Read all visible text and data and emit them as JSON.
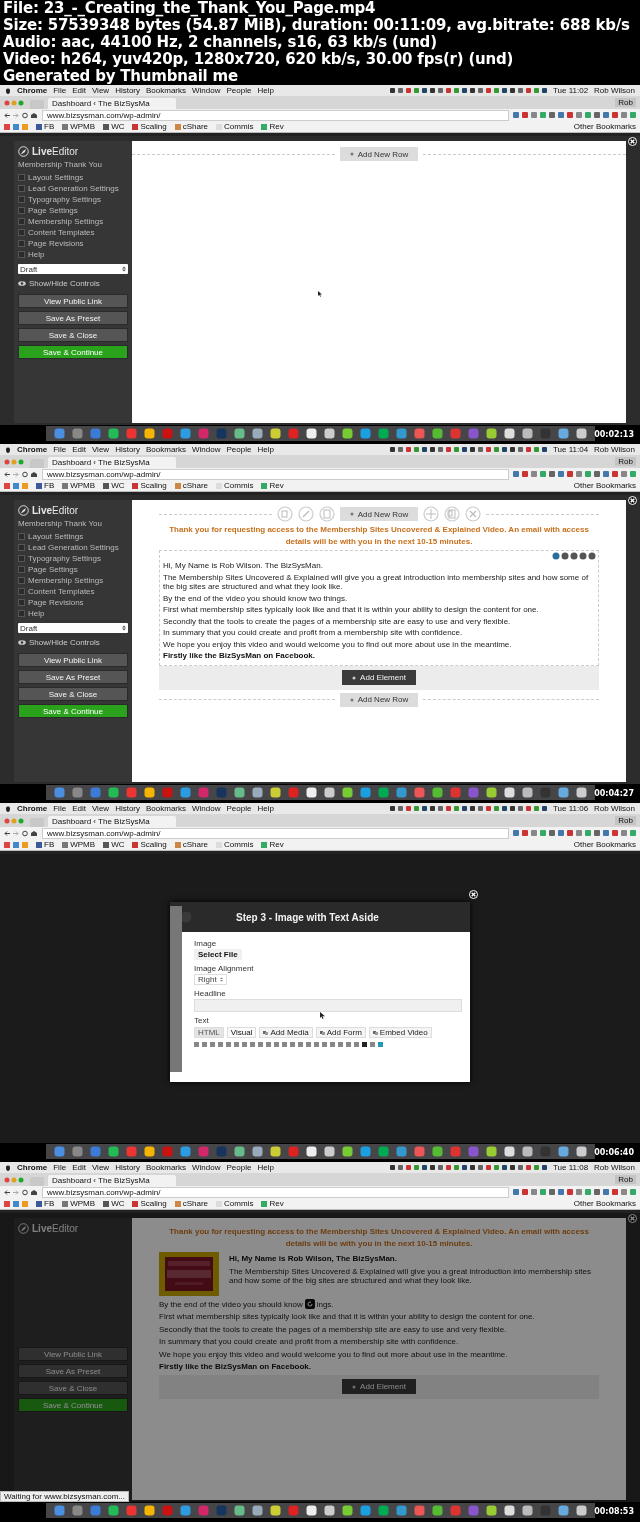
{
  "file_info": [
    "File: 23_-_Creating_the_Thank_You_Page.mp4",
    "Size: 57539348 bytes (54.87 MiB), duration: 00:11:09, avg.bitrate: 688 kb/s",
    "Audio: aac, 44100 Hz, 2 channels, s16, 63 kb/s (und)",
    "Video: h264, yuv420p, 1280x720, 620 kb/s, 30.00 fps(r) (und)",
    "Generated by Thumbnail me"
  ],
  "frames": [
    {
      "kind": "empty",
      "menu_bar": {
        "app": "Chrome",
        "menus": [
          "File",
          "Edit",
          "View",
          "History",
          "Bookmarks",
          "Window",
          "People",
          "Help"
        ],
        "clock": "Tue 11:02",
        "user": "Rob Wilson"
      },
      "browser": {
        "tab_title": "Dashboard ‹ The BizSysMa",
        "profile": "Rob",
        "url": "www.bizsysman.com/wp-admin/",
        "bookmarks": [
          "FB",
          "WPMB",
          "WC",
          "Scaling",
          "cShare",
          "Commis",
          "Rev"
        ],
        "other_bookmarks": "Other Bookmarks"
      },
      "sidebar": {
        "logo": "**Live**Editor",
        "subtitle": "Membership Thank You",
        "items": [
          {
            "label": "Layout Settings",
            "checked": false
          },
          {
            "label": "Lead Generation Settings",
            "checked": false
          },
          {
            "label": "Typography Settings",
            "checked": false
          },
          {
            "label": "Page Settings",
            "checked": false
          },
          {
            "label": "Membership Settings",
            "checked": false
          },
          {
            "label": "Content Templates",
            "checked": false
          },
          {
            "label": "Page Revisions",
            "checked": false
          },
          {
            "label": "Help",
            "checked": false
          }
        ],
        "status": "Draft",
        "toggle": "Show/Hide Controls",
        "buttons": [
          {
            "label": "View Public Link",
            "kind": "default"
          },
          {
            "label": "Save As Preset",
            "kind": "default"
          },
          {
            "label": "Save & Close",
            "kind": "default"
          },
          {
            "label": "Save & Continue",
            "kind": "primary"
          }
        ]
      },
      "add_row": "Add New Row",
      "timestamp": "00:02:13"
    },
    {
      "kind": "content",
      "menu_bar": {
        "app": "Chrome",
        "menus": [
          "File",
          "Edit",
          "View",
          "History",
          "Bookmarks",
          "Window",
          "People",
          "Help"
        ],
        "clock": "Tue 11:04",
        "user": "Rob Wilson"
      },
      "browser": {
        "tab_title": "Dashboard ‹ The BizSysMa",
        "profile": "Rob",
        "url": "www.bizsysman.com/wp-admin/",
        "bookmarks": [
          "FB",
          "WPMB",
          "WC",
          "Scaling",
          "cShare",
          "Commis",
          "Rev"
        ],
        "other_bookmarks": "Other Bookmarks"
      },
      "sidebar": {
        "logo": "**Live**Editor",
        "subtitle": "Membership Thank You",
        "items": [
          {
            "label": "Layout Settings",
            "checked": false
          },
          {
            "label": "Lead Generation Settings",
            "checked": false
          },
          {
            "label": "Typography Settings",
            "checked": false
          },
          {
            "label": "Page Settings",
            "checked": false
          },
          {
            "label": "Membership Settings",
            "checked": false
          },
          {
            "label": "Content Templates",
            "checked": false
          },
          {
            "label": "Page Revisions",
            "checked": false
          },
          {
            "label": "Help",
            "checked": false
          }
        ],
        "status": "Draft",
        "toggle": "Show/Hide Controls",
        "buttons": [
          {
            "label": "View Public Link",
            "kind": "default"
          },
          {
            "label": "Save As Preset",
            "kind": "default"
          },
          {
            "label": "Save & Close",
            "kind": "default"
          },
          {
            "label": "Save & Continue",
            "kind": "primary"
          }
        ]
      },
      "content": {
        "top_row": "Add New Row",
        "headline": "Thank you for requesting access to the Membership Sites Uncovered & Explained Video. An email with access details will be with you in the next 10-15 minutes.",
        "paragraphs": [
          {
            "text": "Hi, My Name is Rob Wilson. The BizSysMan.",
            "bold": false
          },
          {
            "text": "The Membership Sites Uncovered & Explained will give you a great introduction into membership sites and how some of the big sites are structured and what they look like.",
            "bold": false
          },
          {
            "text": "By the end of the video you should know two things.",
            "bold": false
          },
          {
            "text": "First what membership sites typically look like and that it is within your ability to design the content for one.",
            "bold": false
          },
          {
            "text": "Secondly that the tools to create the pages of a membership site are easy to use and very flexible.",
            "bold": false
          },
          {
            "text": "In summary that you could create and profit from a membership site with confidence.",
            "bold": false
          },
          {
            "text": "We hope you enjoy this video and would welcome you to find out more about use in the meantime.",
            "bold": false
          },
          {
            "text": "Firstly like the BizSysMan on Facebook.",
            "bold": true
          }
        ],
        "add_element": "Add Element",
        "bottom_row": "Add New Row"
      },
      "timestamp": "00:04:27"
    },
    {
      "kind": "dialog",
      "menu_bar": {
        "app": "Chrome",
        "menus": [
          "File",
          "Edit",
          "View",
          "History",
          "Bookmarks",
          "Window",
          "People",
          "Help"
        ],
        "clock": "Tue 11:06",
        "user": "Rob Wilson"
      },
      "browser": {
        "tab_title": "Dashboard ‹ The BizSysMa",
        "profile": "Rob",
        "url": "www.bizsysman.com/wp-admin/",
        "bookmarks": [
          "FB",
          "WPMB",
          "WC",
          "Scaling",
          "cShare",
          "Commis",
          "Rev"
        ],
        "other_bookmarks": "Other Bookmarks"
      },
      "dialog": {
        "title": "Step 3 - Image with Text Aside",
        "image_label": "Image",
        "select_file": "Select File",
        "alignment_label": "Image Alignment",
        "alignment": "Right",
        "headline_label": "Headline",
        "text_label": "Text",
        "editor_tabs": [
          {
            "label": "HTML",
            "selected": false
          },
          {
            "label": "Visual",
            "selected": true
          }
        ],
        "media_buttons": [
          "Add Media",
          "Add Form",
          "Embed Video"
        ]
      },
      "timestamp": "00:06:40"
    },
    {
      "kind": "image_text",
      "menu_bar": {
        "app": "Chrome",
        "menus": [
          "File",
          "Edit",
          "View",
          "History",
          "Bookmarks",
          "Window",
          "People",
          "Help"
        ],
        "clock": "Tue 11:08",
        "user": "Rob Wilson"
      },
      "browser": {
        "tab_title": "Dashboard ‹ The BizSysMa",
        "profile": "Rob",
        "url": "www.bizsysman.com/wp-admin/",
        "bookmarks": [
          "FB",
          "WPMB",
          "WC",
          "Scaling",
          "cShare",
          "Commis",
          "Rev"
        ],
        "other_bookmarks": "Other Bookmarks"
      },
      "sidebar": {
        "logo": "**Live**Editor",
        "buttons": [
          {
            "label": "View Public Link",
            "kind": "default"
          },
          {
            "label": "Save As Preset",
            "kind": "default"
          },
          {
            "label": "Save & Close",
            "kind": "default"
          },
          {
            "label": "Save & Continue",
            "kind": "primary"
          }
        ]
      },
      "content": {
        "headline": "Thank you for requesting access to the Membership Sites Uncovered & Explained Video. An email with access details will be with you in the next 10-15 minutes.",
        "aside_title": "Hi, My Name is Rob Wilson, The BizSysMan.",
        "aside_text": "The Membership Sites Uncovered & Explained will give you a great introduction into membership sites and how some of the big sites are structured and what they look like.",
        "split_line": [
          "By the end of the video you should know",
          "ings."
        ],
        "paragraphs": [
          {
            "text": "First what membership sites typically look like and that it is within your ability to design the content for one.",
            "bold": false
          },
          {
            "text": "Secondly that the tools to create the pages of a membership site are easy to use and very flexible.",
            "bold": false
          },
          {
            "text": "In summary that you could create and profit from a membership site with confidence.",
            "bold": false
          },
          {
            "text": "We hope you enjoy this video and would welcome you to find out more about use in the meantime.",
            "bold": false
          },
          {
            "text": "Firstly like the BizSysMan on Facebook.",
            "bold": true
          }
        ],
        "add_element": "Add Element"
      },
      "status_bar": "Waiting for www.bizsysman.com...",
      "timestamp": "00:08:53"
    }
  ]
}
